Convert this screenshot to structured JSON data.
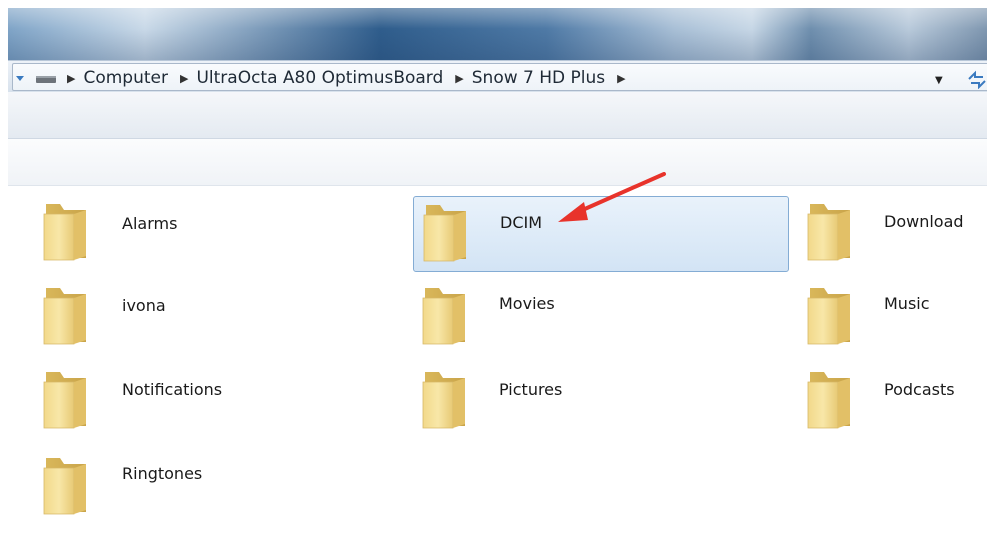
{
  "breadcrumb": {
    "items": [
      "Computer",
      "UltraOcta A80 OptimusBoard",
      "Snow 7 HD Plus"
    ]
  },
  "folders": [
    {
      "label": "Alarms",
      "selected": false
    },
    {
      "label": "DCIM",
      "selected": true
    },
    {
      "label": "Download",
      "selected": false
    },
    {
      "label": "ivona",
      "selected": false
    },
    {
      "label": "Movies",
      "selected": false
    },
    {
      "label": "Music",
      "selected": false
    },
    {
      "label": "Notifications",
      "selected": false
    },
    {
      "label": "Pictures",
      "selected": false
    },
    {
      "label": "Podcasts",
      "selected": false
    },
    {
      "label": "Ringtones",
      "selected": false
    }
  ],
  "icons": {
    "nav": "nav-down-icon",
    "drive": "drive-icon",
    "dropdown": "dropdown-arrow-icon",
    "refresh": "refresh-icon",
    "folder": "folder-icon",
    "annotation": "red-arrow-icon"
  },
  "colors": {
    "selection_border": "#84acd4",
    "annotation": "#e8332b"
  }
}
